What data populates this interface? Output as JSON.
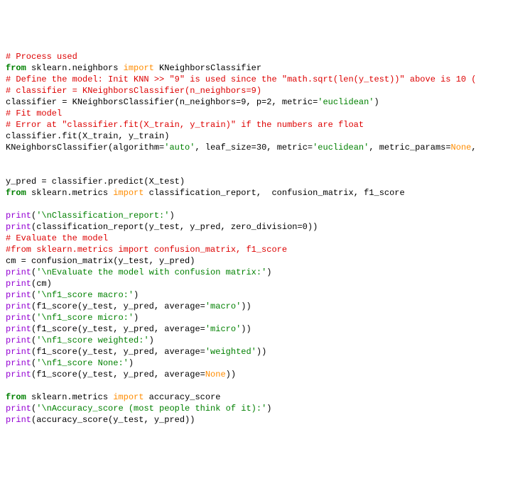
{
  "lines": [
    [
      {
        "t": "# Process used",
        "c": "c-comment"
      }
    ],
    [
      {
        "t": "from",
        "c": "c-kw"
      },
      {
        "t": " sklearn.neighbors ",
        "c": "c-default"
      },
      {
        "t": "import",
        "c": "c-import"
      },
      {
        "t": " KNeighborsClassifier",
        "c": "c-default"
      }
    ],
    [
      {
        "t": "# Define the model: Init KNN >> \"9\" is used since the \"math.sqrt(len(y_test))\" above is 10 (",
        "c": "c-comment"
      }
    ],
    [
      {
        "t": "# classifier = KNeighborsClassifier(n_neighbors=9)",
        "c": "c-comment"
      }
    ],
    [
      {
        "t": "classifier = KNeighborsClassifier(n_neighbors=9, p=2, metric=",
        "c": "c-default"
      },
      {
        "t": "'euclidean'",
        "c": "c-str"
      },
      {
        "t": ")",
        "c": "c-default"
      }
    ],
    [
      {
        "t": "# Fit model",
        "c": "c-comment"
      }
    ],
    [
      {
        "t": "# Error at \"classifier.fit(X_train, y_train)\" if the numbers are float",
        "c": "c-comment"
      }
    ],
    [
      {
        "t": "classifier.fit(X_train, y_train)",
        "c": "c-default"
      }
    ],
    [
      {
        "t": "KNeighborsClassifier(algorithm=",
        "c": "c-default"
      },
      {
        "t": "'auto'",
        "c": "c-str"
      },
      {
        "t": ", leaf_size=30, metric=",
        "c": "c-default"
      },
      {
        "t": "'euclidean'",
        "c": "c-str"
      },
      {
        "t": ", metric_params=",
        "c": "c-default"
      },
      {
        "t": "None",
        "c": "c-none"
      },
      {
        "t": ",",
        "c": "c-default"
      }
    ],
    [
      {
        "t": "",
        "c": "c-default"
      }
    ],
    [
      {
        "t": "",
        "c": "c-default"
      }
    ],
    [
      {
        "t": "y_pred = classifier.predict(X_test)",
        "c": "c-default"
      }
    ],
    [
      {
        "t": "from",
        "c": "c-kw"
      },
      {
        "t": " sklearn.metrics ",
        "c": "c-default"
      },
      {
        "t": "import",
        "c": "c-import"
      },
      {
        "t": " classification_report,  confusion_matrix, f1_score",
        "c": "c-default"
      }
    ],
    [
      {
        "t": "",
        "c": "c-default"
      }
    ],
    [
      {
        "t": "print",
        "c": "c-func"
      },
      {
        "t": "(",
        "c": "c-default"
      },
      {
        "t": "'\\nClassification_report:'",
        "c": "c-str"
      },
      {
        "t": ")",
        "c": "c-default"
      }
    ],
    [
      {
        "t": "print",
        "c": "c-func"
      },
      {
        "t": "(classification_report(y_test, y_pred, zero_division=0))",
        "c": "c-default"
      }
    ],
    [
      {
        "t": "# Evaluate the model",
        "c": "c-comment"
      }
    ],
    [
      {
        "t": "#from sklearn.metrics import confusion_matrix, f1_score",
        "c": "c-comment"
      }
    ],
    [
      {
        "t": "cm = confusion_matrix(y_test, y_pred)",
        "c": "c-default"
      }
    ],
    [
      {
        "t": "print",
        "c": "c-func"
      },
      {
        "t": "(",
        "c": "c-default"
      },
      {
        "t": "'\\nEvaluate the model with confusion matrix:'",
        "c": "c-str"
      },
      {
        "t": ")",
        "c": "c-default"
      }
    ],
    [
      {
        "t": "print",
        "c": "c-func"
      },
      {
        "t": "(cm)",
        "c": "c-default"
      }
    ],
    [
      {
        "t": "print",
        "c": "c-func"
      },
      {
        "t": "(",
        "c": "c-default"
      },
      {
        "t": "'\\nf1_score macro:'",
        "c": "c-str"
      },
      {
        "t": ")",
        "c": "c-default"
      }
    ],
    [
      {
        "t": "print",
        "c": "c-func"
      },
      {
        "t": "(f1_score(y_test, y_pred, average=",
        "c": "c-default"
      },
      {
        "t": "'macro'",
        "c": "c-str"
      },
      {
        "t": "))",
        "c": "c-default"
      }
    ],
    [
      {
        "t": "print",
        "c": "c-func"
      },
      {
        "t": "(",
        "c": "c-default"
      },
      {
        "t": "'\\nf1_score micro:'",
        "c": "c-str"
      },
      {
        "t": ")",
        "c": "c-default"
      }
    ],
    [
      {
        "t": "print",
        "c": "c-func"
      },
      {
        "t": "(f1_score(y_test, y_pred, average=",
        "c": "c-default"
      },
      {
        "t": "'micro'",
        "c": "c-str"
      },
      {
        "t": "))",
        "c": "c-default"
      }
    ],
    [
      {
        "t": "print",
        "c": "c-func"
      },
      {
        "t": "(",
        "c": "c-default"
      },
      {
        "t": "'\\nf1_score weighted:'",
        "c": "c-str"
      },
      {
        "t": ")",
        "c": "c-default"
      }
    ],
    [
      {
        "t": "print",
        "c": "c-func"
      },
      {
        "t": "(f1_score(y_test, y_pred, average=",
        "c": "c-default"
      },
      {
        "t": "'weighted'",
        "c": "c-str"
      },
      {
        "t": "))",
        "c": "c-default"
      }
    ],
    [
      {
        "t": "print",
        "c": "c-func"
      },
      {
        "t": "(",
        "c": "c-default"
      },
      {
        "t": "'\\nf1_score None:'",
        "c": "c-str"
      },
      {
        "t": ")",
        "c": "c-default"
      }
    ],
    [
      {
        "t": "print",
        "c": "c-func"
      },
      {
        "t": "(f1_score(y_test, y_pred, average=",
        "c": "c-default"
      },
      {
        "t": "None",
        "c": "c-none"
      },
      {
        "t": "))",
        "c": "c-default"
      }
    ],
    [
      {
        "t": "",
        "c": "c-default"
      }
    ],
    [
      {
        "t": "from",
        "c": "c-kw"
      },
      {
        "t": " sklearn.metrics ",
        "c": "c-default"
      },
      {
        "t": "import",
        "c": "c-import"
      },
      {
        "t": " accuracy_score",
        "c": "c-default"
      }
    ],
    [
      {
        "t": "print",
        "c": "c-func"
      },
      {
        "t": "(",
        "c": "c-default"
      },
      {
        "t": "'\\nAccuracy_score (most people think of it):'",
        "c": "c-str"
      },
      {
        "t": ")",
        "c": "c-default"
      }
    ],
    [
      {
        "t": "print",
        "c": "c-func"
      },
      {
        "t": "(accuracy_score(y_test, y_pred))",
        "c": "c-default"
      }
    ]
  ]
}
